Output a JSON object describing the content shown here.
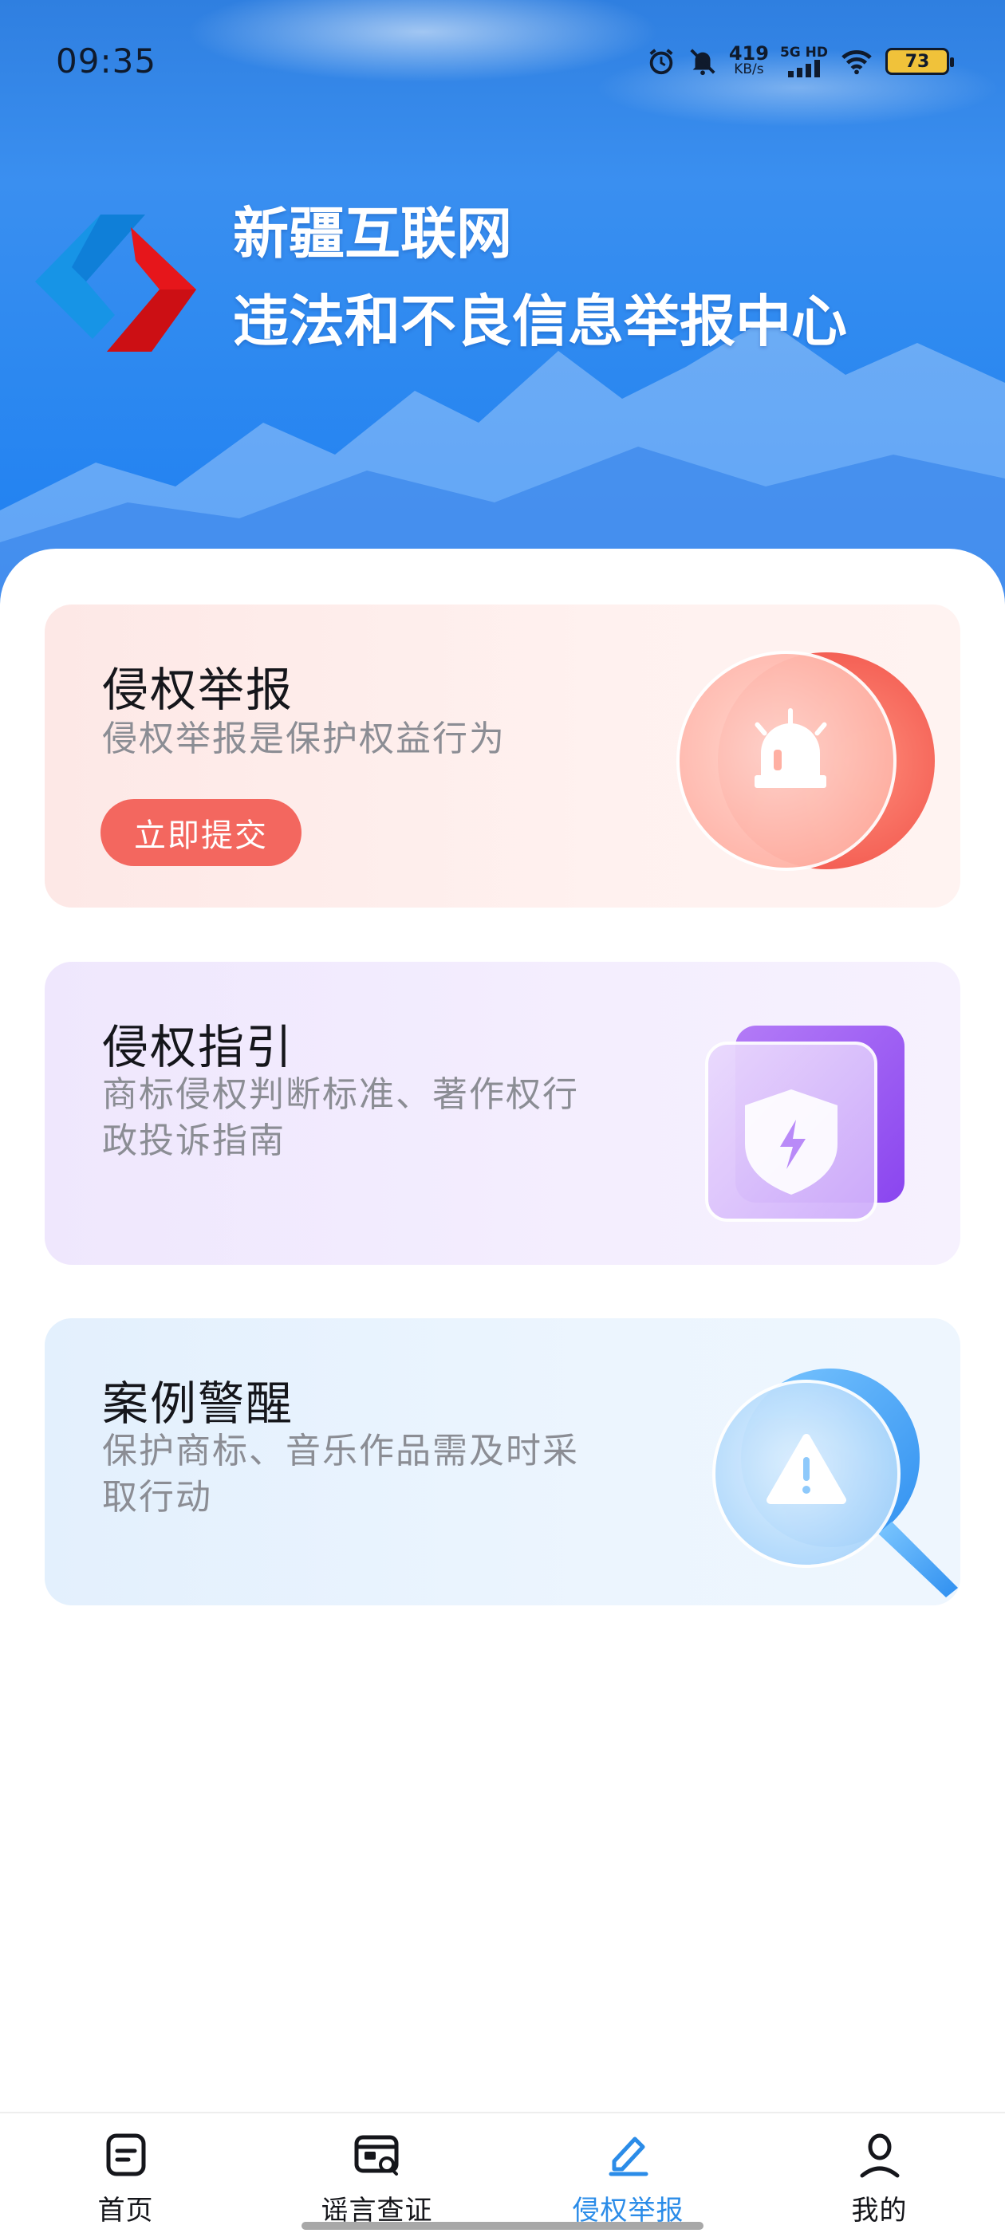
{
  "status_bar": {
    "time": "09:35",
    "net_speed_value": "419",
    "net_speed_unit": "KB/s",
    "signal_label": "5G HD",
    "battery": "73",
    "icons": [
      "alarm-icon",
      "mute-icon",
      "cellular-signal-icon",
      "wifi-icon",
      "battery-icon"
    ]
  },
  "header": {
    "title": "新疆互联网",
    "subtitle": "违法和不良信息举报中心"
  },
  "cards": [
    {
      "title": "侵权举报",
      "description": "侵权举报是保护权益行为",
      "button_label": "立即提交",
      "icon": "alarm-light-icon",
      "color": "#f3675f"
    },
    {
      "title": "侵权指引",
      "description": "商标侵权判断标准、著作权行政投诉指南",
      "icon": "shield-lightning-icon",
      "color": "#9b5cf3"
    },
    {
      "title": "案例警醒",
      "description": "保护商标、音乐作品需及时采取行动",
      "icon": "magnifier-warning-icon",
      "color": "#3a9af0"
    }
  ],
  "bottom_nav": {
    "active_index": 2,
    "active_color": "#2b8ce8",
    "items": [
      {
        "label": "首页",
        "icon": "home-doc-icon"
      },
      {
        "label": "谣言查证",
        "icon": "rumor-check-icon"
      },
      {
        "label": "侵权举报",
        "icon": "pen-report-icon"
      },
      {
        "label": "我的",
        "icon": "user-icon"
      }
    ]
  }
}
